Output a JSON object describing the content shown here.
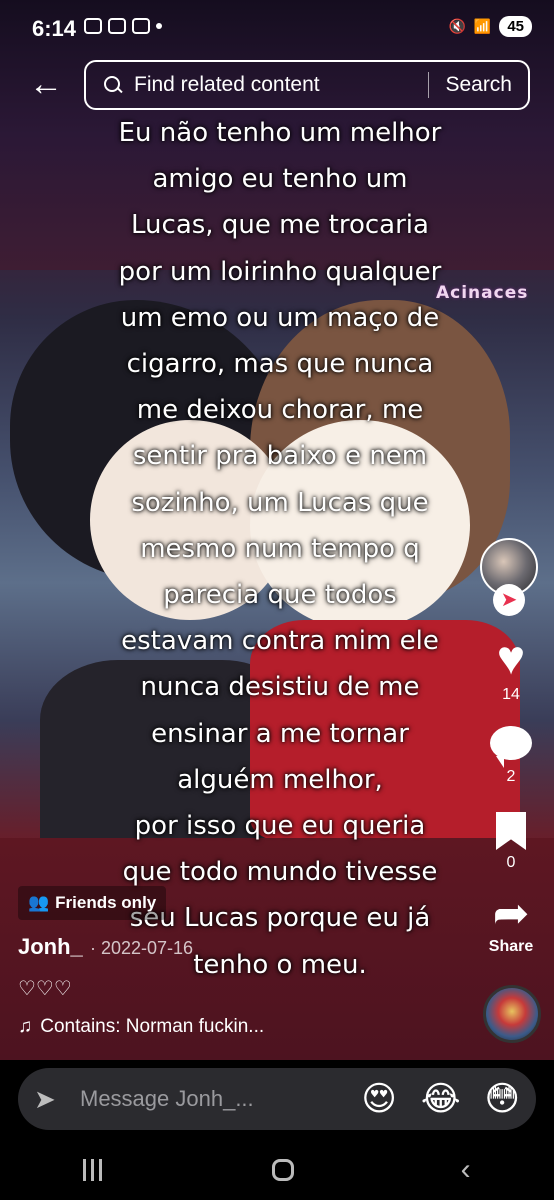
{
  "status_bar": {
    "time": "6:14",
    "battery": "45"
  },
  "top_bar": {
    "search_placeholder": "Find related content",
    "search_button": "Search"
  },
  "video": {
    "watermark": "Acinaces",
    "overlay_lines": [
      "Eu não tenho um melhor",
      "amigo eu tenho um",
      "Lucas, que me trocaria",
      "por um loirinho qualquer",
      "um emo ou um maço de",
      "cigarro, mas que nunca",
      "me deixou chorar, me",
      "sentir pra baixo e nem",
      "sozinho, um Lucas que",
      "mesmo num tempo q",
      "parecia que todos",
      "estavam contra mim ele",
      "nunca desistiu de me",
      "ensinar a me tornar",
      "alguém melhor,",
      "por isso que eu queria",
      "que todo mundo tivesse",
      "seu Lucas porque eu já",
      "tenho o meu."
    ]
  },
  "rail": {
    "likes": "14",
    "comments": "2",
    "saves": "0",
    "share_label": "Share"
  },
  "post": {
    "privacy": "Friends only",
    "author": "Jonh_",
    "date": "· 2022-07-16",
    "caption": "♡♡♡",
    "music": "Contains: Norman fuckin..."
  },
  "message_bar": {
    "placeholder": "Message Jonh_...",
    "emojis": [
      "😍",
      "😂",
      "😳"
    ]
  }
}
